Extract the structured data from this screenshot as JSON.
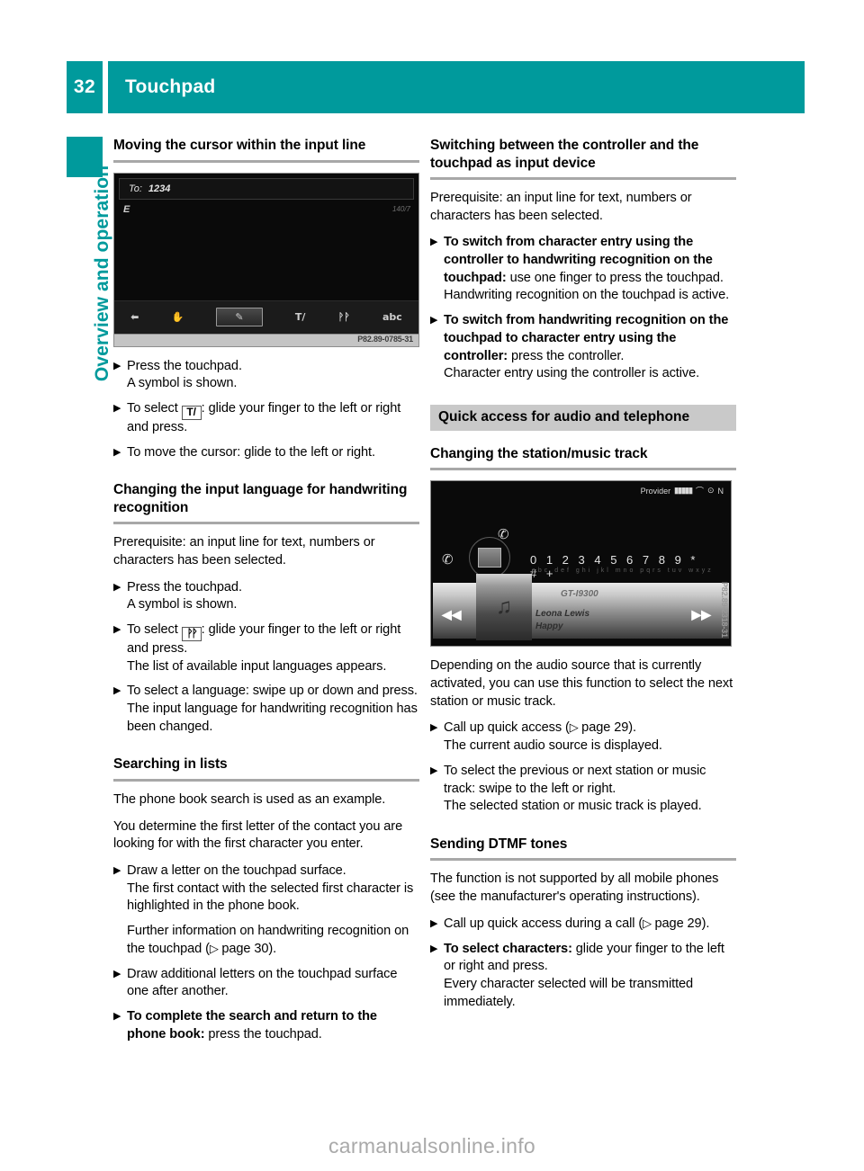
{
  "theme": {
    "accent": "#009a9c",
    "banner_bg": "#c9c9c9",
    "rule": "#a8a8a8"
  },
  "header": {
    "page_number": "32",
    "title": "Touchpad"
  },
  "sidebar": {
    "chapter_label": "Overview and operation"
  },
  "left_column": {
    "section1": {
      "heading": "Moving the cursor within the input line",
      "figure": {
        "input_label": "To:",
        "input_value": "1234",
        "char_left": "E",
        "counter": "140/7",
        "toolbar_icons": [
          "back-arrow-icon",
          "hand-icon",
          "pen-icon",
          "T/",
          "handwriting-icon",
          "abc"
        ],
        "toolbar_selected_index": 2,
        "code": "P82.89-0785-31"
      },
      "steps": [
        {
          "text": "Press the touchpad.",
          "sub": "A symbol is shown."
        },
        {
          "pre": "To select ",
          "glyph": "T/",
          "post": ": glide your finger to the left or right and press."
        },
        {
          "text": "To move the cursor: glide to the left or right."
        }
      ]
    },
    "section2": {
      "heading": "Changing the input language for handwriting recognition",
      "intro": "Prerequisite: an input line for text, numbers or characters has been selected.",
      "steps": [
        {
          "text": "Press the touchpad.",
          "sub": "A symbol is shown."
        },
        {
          "pre": "To select ",
          "glyph": "handwriting",
          "post": ": glide your finger to the left or right and press.",
          "sub": "The list of available input languages appears."
        },
        {
          "text": "To select a language: swipe up or down and press.",
          "sub": "The input language for handwriting recognition has been changed."
        }
      ]
    },
    "section3": {
      "heading": "Searching in lists",
      "intro1": "The phone book search is used as an example.",
      "intro2": "You determine the first letter of the contact you are looking for with the first character you enter.",
      "steps": [
        {
          "text": "Draw a letter on the touchpad surface.",
          "sub": "The first contact with the selected first character is highlighted in the phone book.",
          "sub2_pre": "Further information on handwriting recognition on the touchpad (",
          "sub2_ref": "page 30",
          "sub2_post": ")."
        },
        {
          "text": "Draw additional letters on the touchpad surface one after another."
        },
        {
          "bold": "To complete the search and return to the phone book:",
          "rest": " press the touchpad."
        }
      ]
    }
  },
  "right_column": {
    "section1": {
      "heading": "Switching between the controller and the touchpad as input device",
      "intro": "Prerequisite: an input line for text, numbers or characters has been selected.",
      "steps": [
        {
          "bold": "To switch from character entry using the controller to handwriting recognition on the touchpad:",
          "rest": " use one finger to press the touchpad.",
          "sub": "Handwriting recognition on the touchpad is active."
        },
        {
          "bold": "To switch from handwriting recognition on the touchpad to character entry using the controller:",
          "rest": " press the controller.",
          "sub": "Character entry using the controller is active."
        }
      ]
    },
    "banner": "Quick access for audio and telephone",
    "section2": {
      "heading": "Changing the station/music track",
      "figure": {
        "provider_label": "Provider",
        "signal_bars": "▮▮▮▮▮",
        "dtmf_row": "0 1 2 3 4 5 6 7 8 9 * # +",
        "dtmf_sub": "abc def ghi jkl mno pqrs tuv wxyz",
        "device_name": "GT-I9300",
        "artist": "Leona Lewis",
        "track": "Happy",
        "prev_icon": "skip-previous-icon",
        "next_icon": "skip-next-icon",
        "code": "P82.89-2318-31"
      },
      "intro": "Depending on the audio source that is currently activated, you can use this function to select the next station or music track.",
      "steps": [
        {
          "pre": "Call up quick access (",
          "ref": "page 29",
          "post": ").",
          "sub": "The current audio source is displayed."
        },
        {
          "text": "To select the previous or next station or music track: swipe to the left or right.",
          "sub": "The selected station or music track is played."
        }
      ]
    },
    "section3": {
      "heading": "Sending DTMF tones",
      "intro": "The function is not supported by all mobile phones (see the manufacturer's operating instructions).",
      "steps": [
        {
          "pre": "Call up quick access during a call (",
          "ref": "page 29",
          "post": ")."
        },
        {
          "bold": "To select characters:",
          "rest": " glide your finger to the left or right and press.",
          "sub": "Every character selected will be transmitted immediately."
        }
      ]
    }
  },
  "watermark": "carmanualsonline.info"
}
